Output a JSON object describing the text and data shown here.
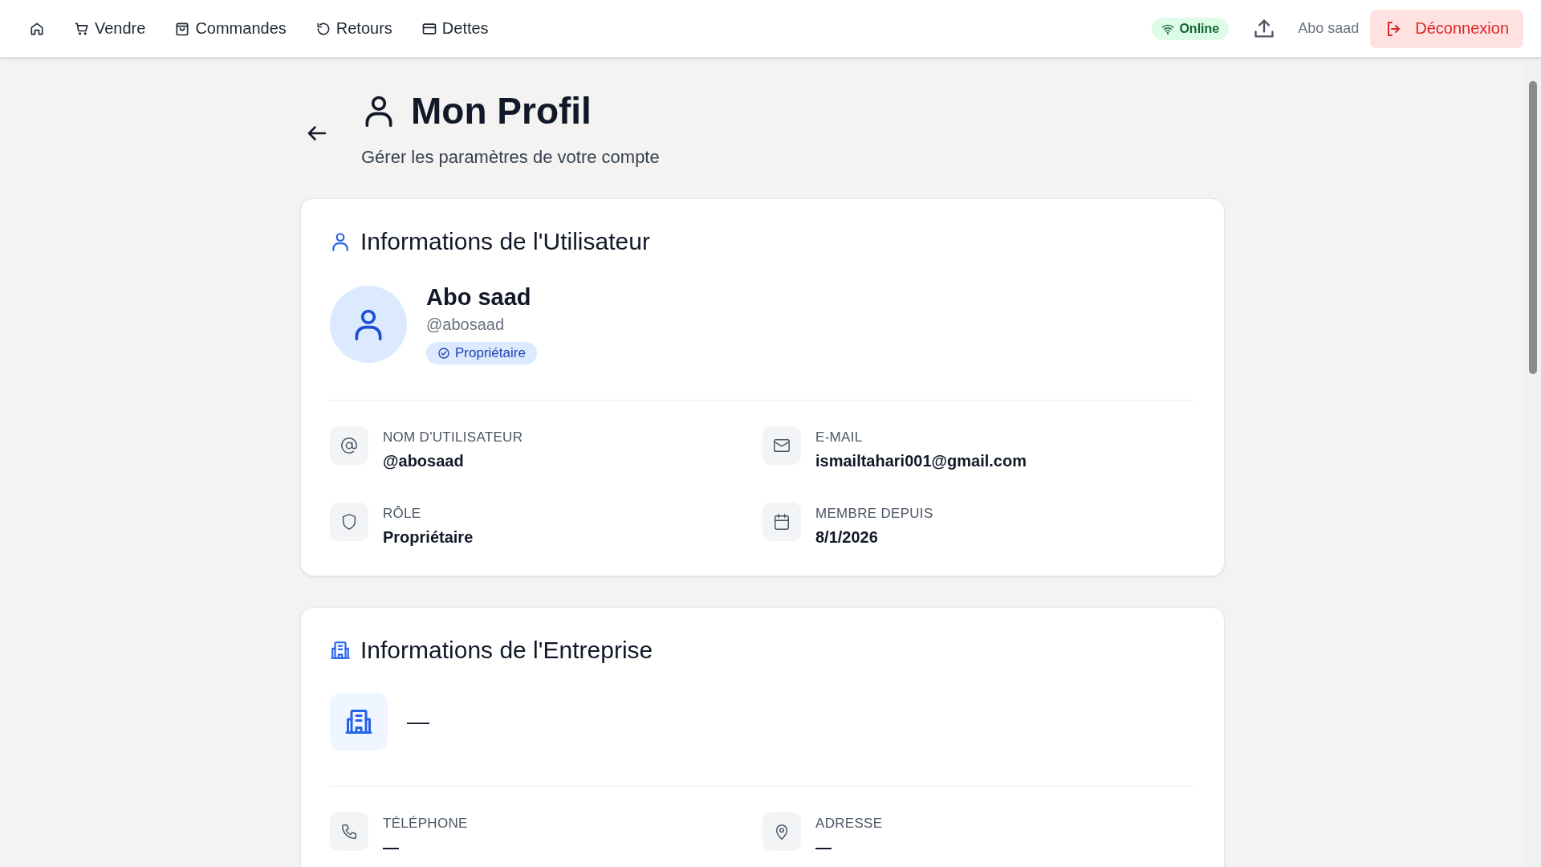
{
  "nav": {
    "links": [
      {
        "kind": "home"
      },
      {
        "kind": "cart",
        "label": "Vendre"
      },
      {
        "kind": "bag",
        "label": "Commandes"
      },
      {
        "kind": "undo",
        "label": "Retours"
      },
      {
        "kind": "card",
        "label": "Dettes"
      }
    ],
    "status": "Online",
    "user": "Abo saad",
    "logout": "Déconnexion"
  },
  "header": {
    "title": "Mon Profil",
    "subtitle": "Gérer les paramètres de votre compte"
  },
  "user_card": {
    "title": "Informations de l'Utilisateur",
    "name": "Abo saad",
    "handle": "@abosaad",
    "badge": "Propriétaire",
    "fields": [
      {
        "kind": "at",
        "label": "NOM D'UTILISATEUR",
        "value": "@abosaad"
      },
      {
        "kind": "mail",
        "label": "E-MAIL",
        "value": "ismailtahari001@gmail.com"
      },
      {
        "kind": "shield",
        "label": "RÔLE",
        "value": "Propriétaire"
      },
      {
        "kind": "calendar",
        "label": "MEMBRE DEPUIS",
        "value": "8/1/2026"
      }
    ]
  },
  "company_card": {
    "title": "Informations de l'Entreprise",
    "name": "—",
    "fields": [
      {
        "kind": "phone",
        "label": "TÉLÉPHONE",
        "value": "—"
      },
      {
        "kind": "pin",
        "label": "ADRESSE",
        "value": "—"
      }
    ]
  }
}
